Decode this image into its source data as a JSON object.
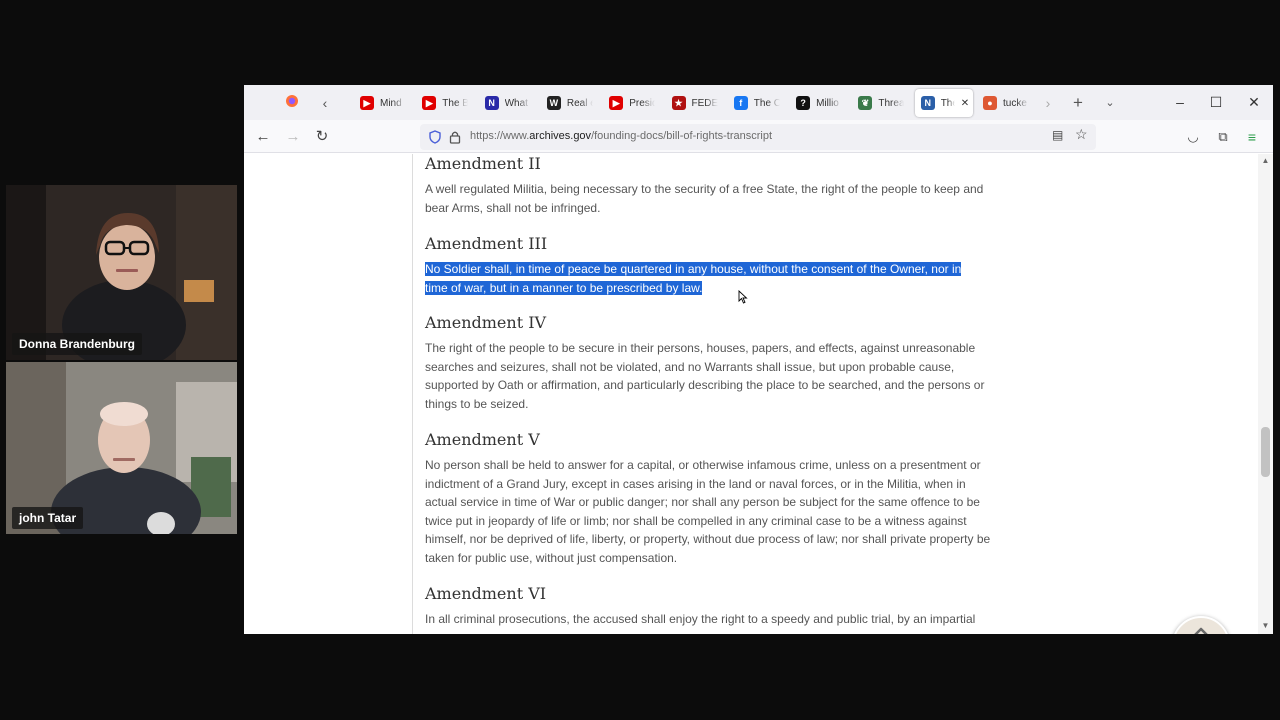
{
  "participants": [
    {
      "name": "Donna Brandenburg"
    },
    {
      "name": "john Tatar"
    }
  ],
  "browser": {
    "tabs": [
      {
        "title": "Mind",
        "icon": "youtube-icon",
        "color": "#e00000"
      },
      {
        "title": "The B",
        "icon": "youtube-icon",
        "color": "#e00000"
      },
      {
        "title": "What",
        "icon": "n-icon",
        "color": "#2a2aa8"
      },
      {
        "title": "Real e",
        "icon": "wikipedia-icon",
        "color": "#222222"
      },
      {
        "title": "Presid",
        "icon": "youtube-icon",
        "color": "#e00000"
      },
      {
        "title": "FEDER",
        "icon": "star-icon",
        "color": "#b01010"
      },
      {
        "title": "The C",
        "icon": "facebook-icon",
        "color": "#1877f2"
      },
      {
        "title": "Millio",
        "icon": "question-icon",
        "color": "#111111"
      },
      {
        "title": "Threat",
        "icon": "leaf-icon",
        "color": "#3a7a4a"
      },
      {
        "title": "The",
        "icon": "n-circle-icon",
        "color": "#2b5fa8"
      },
      {
        "title": "tucke",
        "icon": "duckduckgo-icon",
        "color": "#de5833"
      }
    ],
    "url_prefix": "https://www.",
    "url_host": "archives.gov",
    "url_path": "/founding-docs/bill-of-rights-transcript"
  },
  "page": {
    "amendments": [
      {
        "title": "Amendment II",
        "text": "A well regulated Militia, being necessary to the security of a free State, the right of the people to keep and bear Arms, shall not be infringed."
      },
      {
        "title": "Amendment III",
        "line1": "No Soldier shall, in time of peace be quartered in any house, without the consent of the Owner, nor in",
        "line2": "time of war, but in a manner to be prescribed by law."
      },
      {
        "title": "Amendment IV",
        "text": "The right of the people to be secure in their persons, houses, papers, and effects, against unreasonable searches and seizures, shall not be violated, and no Warrants shall issue, but upon probable cause, supported by Oath or affirmation, and particularly describing the place to be searched, and the persons or things to be seized."
      },
      {
        "title": "Amendment V",
        "text": "No person shall be held to answer for a capital, or otherwise infamous crime, unless on a presentment or indictment of a Grand Jury, except in cases arising in the land or naval forces, or in the Militia, when in actual service in time of War or public danger; nor shall any person be subject for the same offence to be twice put in jeopardy of life or limb; nor shall be compelled in any criminal case to be a witness against himself, nor be deprived of life, liberty, or property, without due process of law; nor shall private property be taken for public use, without just compensation."
      },
      {
        "title": "Amendment VI",
        "text": "In all criminal prosecutions, the accused shall enjoy the right to a speedy and public trial, by an impartial"
      }
    ]
  },
  "colors": {
    "selection": "#1f66d6",
    "background": "#0c0c0c"
  }
}
